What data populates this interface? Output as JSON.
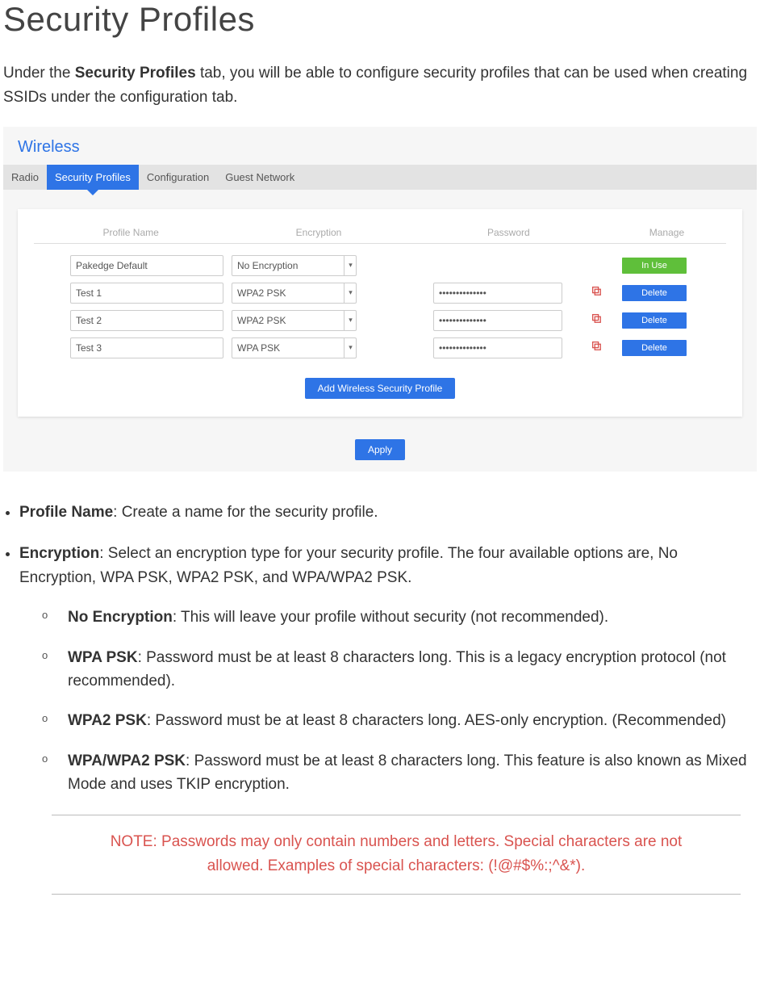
{
  "heading": "Security Profiles",
  "intro_before_bold": "Under the ",
  "intro_bold": "Security Profiles",
  "intro_after_bold": " tab, you will be able to configure security profiles that can be used when creating SSIDs under the configuration tab.",
  "wireless": {
    "title": "Wireless",
    "tabs": [
      "Radio",
      "Security Profiles",
      "Configuration",
      "Guest Network"
    ],
    "active_tab_index": 1,
    "columns": {
      "name": "Profile Name",
      "enc": "Encryption",
      "pass": "Password",
      "manage": "Manage"
    },
    "rows": [
      {
        "name": "Pakedge Default",
        "enc": "No Encryption",
        "pass": "",
        "status": "inuse",
        "status_label": "In Use"
      },
      {
        "name": "Test 1",
        "enc": "WPA2 PSK",
        "pass": "••••••••••••••",
        "status": "delete",
        "status_label": "Delete"
      },
      {
        "name": "Test 2",
        "enc": "WPA2 PSK",
        "pass": "••••••••••••••",
        "status": "delete",
        "status_label": "Delete"
      },
      {
        "name": "Test 3",
        "enc": "WPA PSK",
        "pass": "••••••••••••••",
        "status": "delete",
        "status_label": "Delete"
      }
    ],
    "add_button": "Add Wireless Security Profile",
    "apply_button": "Apply"
  },
  "bullets": {
    "profile_name_bold": "Profile Name",
    "profile_name_rest": ": Create a name for the security profile.",
    "encryption_bold": "Encryption",
    "encryption_rest": ": Select an encryption type for your security profile. The four available options are, No Encryption, WPA PSK, WPA2 PSK, and WPA/WPA2 PSK.",
    "sub": {
      "noenc_bold": "No Encryption",
      "noenc_rest": ": This will leave your profile without security (not recommended).",
      "wpa_bold": "WPA PSK",
      "wpa_rest": ": Password must be at least 8 characters long. This is a legacy encryption protocol (not recommended).",
      "wpa2_bold": "WPA2 PSK",
      "wpa2_rest": ": Password must be at least 8 characters long. AES-only encryption. (Recommended)",
      "mixed_bold": "WPA/WPA2 PSK",
      "mixed_rest": ": Password must be at least 8 characters long. This feature is also known as Mixed Mode and uses TKIP encryption."
    }
  },
  "note": "NOTE: Passwords may only contain numbers and letters. Special characters are not allowed. Examples of special characters: (!@#$%:;^&*)."
}
